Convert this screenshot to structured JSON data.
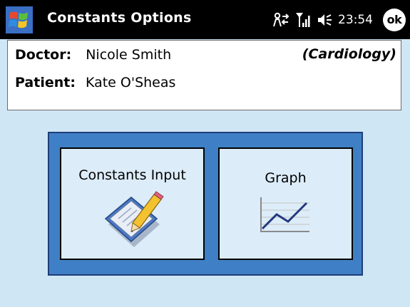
{
  "titlebar": {
    "title": "Constants Options",
    "clock": "23:54",
    "ok_label": "ok",
    "icons": {
      "start": "windows-start-icon",
      "connectivity": "connectivity-icon",
      "signal": "signal-strength-icon",
      "volume": "volume-icon"
    }
  },
  "info": {
    "doctor_label": "Doctor:",
    "doctor_name": "Nicole Smith",
    "specialty": "(Cardiology)",
    "patient_label": "Patient:",
    "patient_name": "Kate O'Sheas"
  },
  "options": {
    "constants_input": {
      "label": "Constants Input",
      "icon": "edit-form-icon"
    },
    "graph": {
      "label": "Graph",
      "icon": "line-graph-icon"
    }
  },
  "colors": {
    "background": "#cfe6f5",
    "titlebar": "#000000",
    "frame": "#3f7fc5",
    "button": "#dcecf8"
  }
}
